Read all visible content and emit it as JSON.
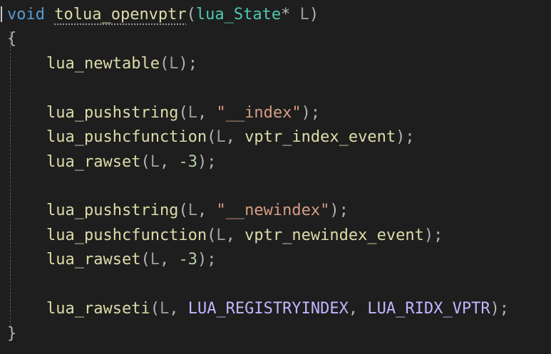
{
  "editor": {
    "line1": {
      "kw": "void",
      "fn": "tolua_openvptr",
      "open_paren": "(",
      "type": "lua_State",
      "star": "*",
      "param": "L",
      "close_paren": ")"
    },
    "open_brace": "{",
    "close_brace": "}",
    "lines": [
      {
        "fn": "lua_newtable",
        "open": "(",
        "arg": "L",
        "close": ");"
      },
      {
        "fn": "lua_pushstring",
        "open": "(",
        "arg": "L",
        "comma": ",",
        "str": "\"__index\"",
        "close": ");"
      },
      {
        "fn": "lua_pushcfunction",
        "open": "(",
        "arg": "L",
        "comma": ",",
        "arg2": "vptr_index_event",
        "close": ");"
      },
      {
        "fn": "lua_rawset",
        "open": "(",
        "arg": "L",
        "comma": ",",
        "num": "-3",
        "close": ");"
      },
      {
        "fn": "lua_pushstring",
        "open": "(",
        "arg": "L",
        "comma": ",",
        "str": "\"__newindex\"",
        "close": ");"
      },
      {
        "fn": "lua_pushcfunction",
        "open": "(",
        "arg": "L",
        "comma": ",",
        "arg2": "vptr_newindex_event",
        "close": ");"
      },
      {
        "fn": "lua_rawset",
        "open": "(",
        "arg": "L",
        "comma": ",",
        "num": "-3",
        "close": ");"
      },
      {
        "fn": "lua_rawseti",
        "open": "(",
        "arg": "L",
        "comma": ",",
        "m1": "LUA_REGISTRYINDEX",
        "comma2": ",",
        "m2": "LUA_RIDX_VPTR",
        "close": ");"
      }
    ]
  }
}
